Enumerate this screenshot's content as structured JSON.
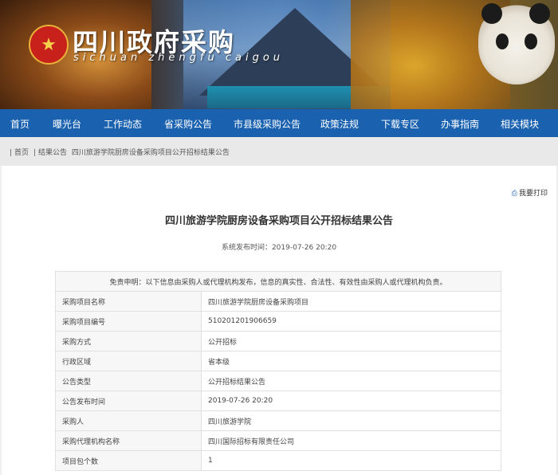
{
  "header": {
    "site_title": "四川政府采购",
    "site_subtitle": "sichuan zhengfu caigou",
    "emblem_icon": "national-emblem-icon"
  },
  "nav": {
    "items": [
      "首页",
      "曝光台",
      "工作动态",
      "省采购公告",
      "市县级采购公告",
      "政策法规",
      "下载专区",
      "办事指南",
      "相关模块"
    ]
  },
  "breadcrumb": {
    "home": "首页",
    "section": "结果公告",
    "current": "四川旅游学院厨房设备采购项目公开招标结果公告"
  },
  "article": {
    "print_label": "我要打印",
    "title": "四川旅游学院厨房设备采购项目公开招标结果公告",
    "publish_time": "系统发布时间：2019-07-26 20:20",
    "disclaimer": "免责申明：以下信息由采购人或代理机构发布，信息的真实性、合法性、有效性由采购人或代理机构负责。",
    "rows": [
      {
        "label": "采购项目名称",
        "value": "四川旅游学院厨房设备采购项目"
      },
      {
        "label": "采购项目编号",
        "value": "510201201906659"
      },
      {
        "label": "采购方式",
        "value": "公开招标"
      },
      {
        "label": "行政区域",
        "value": "省本级"
      },
      {
        "label": "公告类型",
        "value": "公开招标结果公告"
      },
      {
        "label": "公告发布时间",
        "value": "2019-07-26 20:20"
      },
      {
        "label": "采购人",
        "value": "四川旅游学院"
      },
      {
        "label": "采购代理机构名称",
        "value": "四川国际招标有限责任公司"
      },
      {
        "label": "项目包个数",
        "value": "1"
      }
    ]
  },
  "colors": {
    "nav_blue": "#1a62b0",
    "page_gray": "#efefef"
  }
}
